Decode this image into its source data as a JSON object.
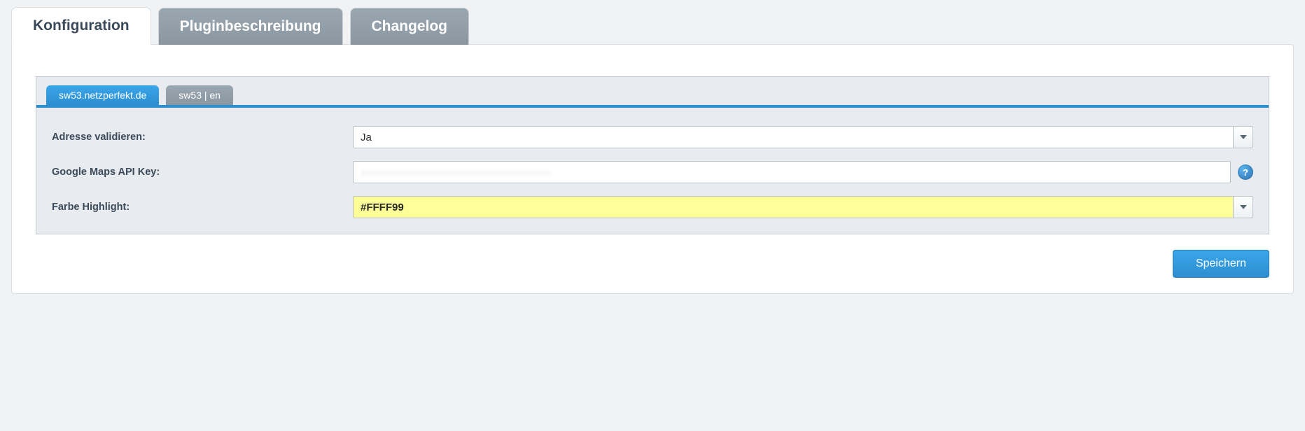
{
  "outer_tabs": {
    "items": [
      {
        "label": "Konfiguration",
        "active": true
      },
      {
        "label": "Pluginbeschreibung",
        "active": false
      },
      {
        "label": "Changelog",
        "active": false
      }
    ]
  },
  "inner_tabs": {
    "items": [
      {
        "label": "sw53.netzperfekt.de",
        "active": true
      },
      {
        "label": "sw53 | en",
        "active": false
      }
    ]
  },
  "form": {
    "validate_address": {
      "label": "Adresse validieren:",
      "value": "Ja"
    },
    "api_key": {
      "label": "Google Maps API Key:",
      "value": "················································"
    },
    "highlight_color": {
      "label": "Farbe Highlight:",
      "value": "#FFFF99"
    }
  },
  "buttons": {
    "save": "Speichern"
  },
  "help_glyph": "?"
}
